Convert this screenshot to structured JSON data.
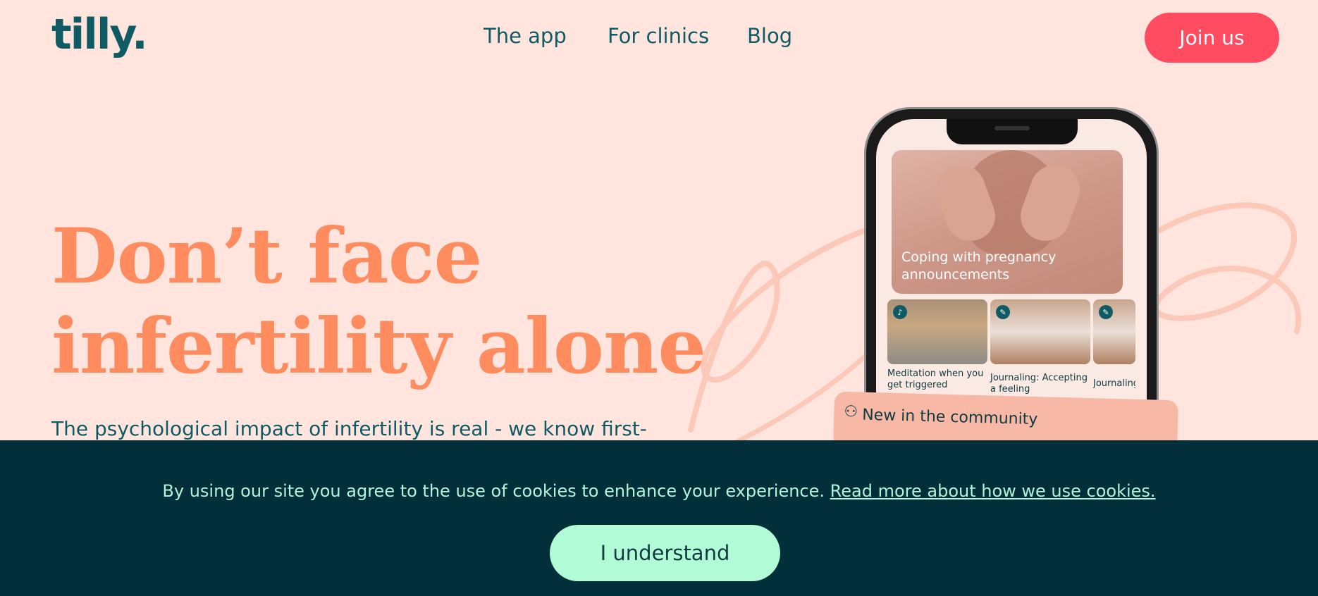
{
  "header": {
    "logo": "tilly.",
    "nav": [
      "The app",
      "For clinics",
      "Blog"
    ],
    "join_label": "Join us"
  },
  "hero": {
    "title_line1": "Don’t face",
    "title_line2": "infertility alone",
    "subtitle": "The psychological impact of infertility is real - we know first-"
  },
  "phone": {
    "featured_title": "Coping with pregnancy announcements",
    "items": [
      {
        "label": "Meditation when you get triggered",
        "icon": "headphones-icon"
      },
      {
        "label": "Journaling: Accepting a feeling",
        "icon": "pencil-icon"
      },
      {
        "label": "Journaling: worries w",
        "icon": "pencil-icon"
      }
    ],
    "community_label": "New in the community"
  },
  "cookie": {
    "text": "By using our site you agree to the use of cookies to enhance your experience. ",
    "link": "Read more about how we use cookies.",
    "button": "I understand"
  },
  "colors": {
    "background": "#ffe5de",
    "brand_teal": "#0f5a63",
    "accent_red": "#ff4c61",
    "hero_orange": "#ff8c5e",
    "cookie_bg": "#022f3a",
    "cookie_mint": "#b2fbd7"
  }
}
